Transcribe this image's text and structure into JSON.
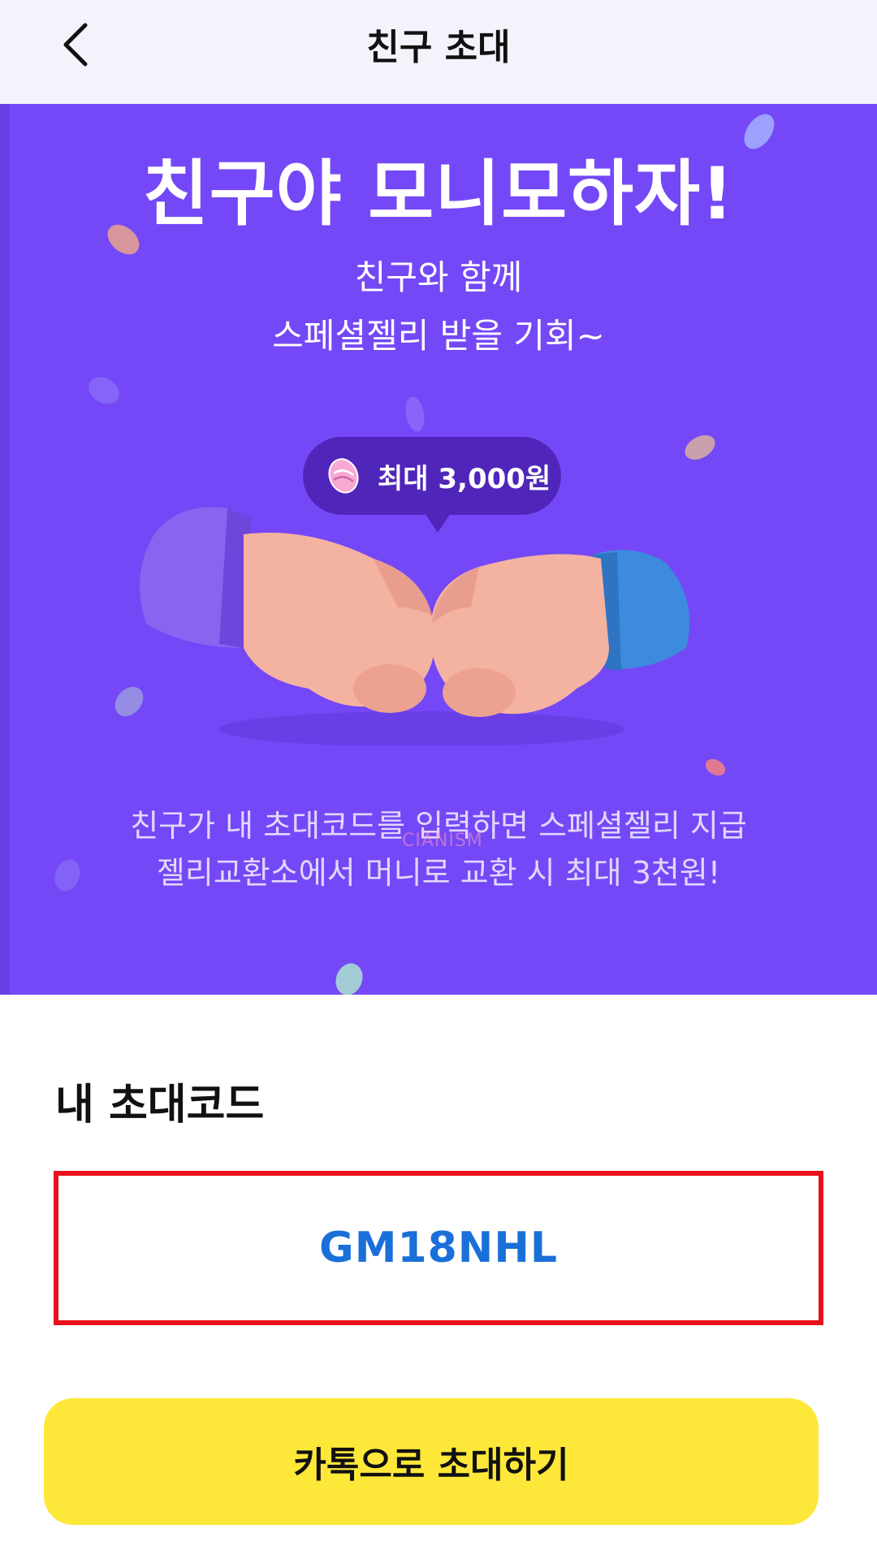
{
  "header": {
    "title": "친구 초대",
    "back_icon": "chevron-left-icon"
  },
  "banner": {
    "headline": "친구야 모니모하자!",
    "subtitle_line1": "친구와 함께",
    "subtitle_line2": "스페셜젤리 받을 기회~",
    "reward_badge": "최대 3,000원",
    "description_line1": "친구가 내 초대코드를 입력하면 스페셜젤리 지급",
    "description_line2": "젤리교환소에서 머니로 교환 시 최대 3천원!",
    "watermark": "CIANISM",
    "background_color": "#7448f6",
    "badge_color": "#4f26b9"
  },
  "invite_code": {
    "label": "내 초대코드",
    "code": "GM18NHL",
    "highlight_color": "#e8111b",
    "code_color": "#1a6fd8"
  },
  "actions": {
    "kakao_invite_label": "카톡으로 초대하기",
    "button_color": "#fde83a"
  }
}
